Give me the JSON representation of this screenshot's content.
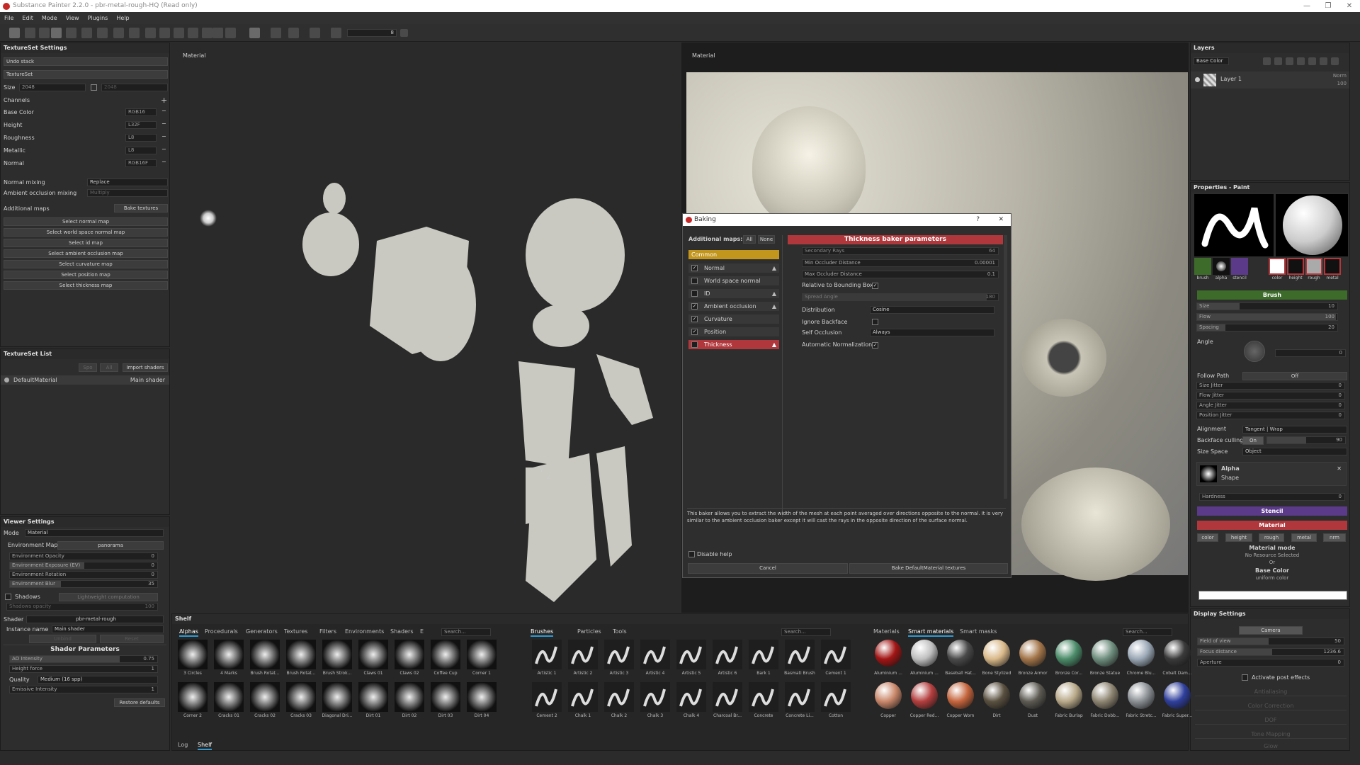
{
  "title": "Substance Painter 2.2.0 - pbr-metal-rough-HQ (Read only)",
  "menu": [
    "File",
    "Edit",
    "Mode",
    "View",
    "Plugins",
    "Help"
  ],
  "toolbar": {
    "brush_size": "8"
  },
  "textureset_settings": {
    "title": "TextureSet Settings",
    "undo": "Undo stack",
    "textureset": "TextureSet",
    "size_label": "Size",
    "size_value": "2048",
    "size_value2": "2048",
    "channels_label": "Channels",
    "channels": [
      {
        "name": "Base Color",
        "format": "RGB16"
      },
      {
        "name": "Height",
        "format": "L32F"
      },
      {
        "name": "Roughness",
        "format": "L8"
      },
      {
        "name": "Metallic",
        "format": "L8"
      },
      {
        "name": "Normal",
        "format": "RGB16F"
      }
    ],
    "normal_mixing_label": "Normal mixing",
    "normal_mixing": "Replace",
    "ao_mixing_label": "Ambient occlusion mixing",
    "ao_mixing": "Multiply",
    "additional_maps_label": "Additional maps",
    "bake_button": "Bake textures",
    "select_buttons": [
      "Select normal map",
      "Select world space normal map",
      "Select id map",
      "Select ambient occlusion map",
      "Select curvature map",
      "Select position map",
      "Select thickness map"
    ]
  },
  "textureset_list": {
    "title": "TextureSet List",
    "btn_a": "Spo",
    "btn_b": "All",
    "import_shaders": "Import shaders",
    "item": "DefaultMaterial",
    "shader": "Main shader"
  },
  "viewer_settings": {
    "title": "Viewer Settings",
    "mode_label": "Mode",
    "mode": "Material",
    "env_map_label": "Environment Map",
    "env_map": "panorama",
    "sliders": [
      {
        "label": "Environment Opacity",
        "value": "0"
      },
      {
        "label": "Environment Exposure (EV)",
        "value": "0"
      },
      {
        "label": "Environment Rotation",
        "value": "0"
      },
      {
        "label": "Environment Blur",
        "value": "35"
      }
    ],
    "shadows_label": "Shadows",
    "shadows_btn": "Lightweight computation",
    "shadows_opacity_label": "Shadows opacity",
    "shadows_opacity": "100",
    "shader_label": "Shader",
    "shader": "pbr-metal-rough",
    "instance_label": "Instance name",
    "instance": "Main shader",
    "btn_a": "Unbind",
    "btn_b": "Reset",
    "shader_params": "Shader Parameters",
    "params": [
      {
        "label": "AO Intensity",
        "value": "0.75"
      },
      {
        "label": "Height force",
        "value": "1"
      }
    ],
    "quality_label": "Quality",
    "quality": "Medium (16 spp)",
    "emissive_label": "Emissive Intensity",
    "emissive": "1",
    "restore": "Restore defaults"
  },
  "viewport_left": {
    "label": "Material"
  },
  "viewport_right": {
    "label": "Material"
  },
  "baking": {
    "title": "Baking",
    "help": "?",
    "close": "✕",
    "additional_maps": "Additional maps:",
    "all": "All",
    "none": "None",
    "common": "Common",
    "maps": [
      {
        "name": "Normal",
        "checked": true,
        "warn": true
      },
      {
        "name": "World space normal",
        "checked": false,
        "warn": false
      },
      {
        "name": "ID",
        "checked": false,
        "warn": true
      },
      {
        "name": "Ambient occlusion",
        "checked": true,
        "warn": true
      },
      {
        "name": "Curvature",
        "checked": true,
        "warn": false
      },
      {
        "name": "Position",
        "checked": true,
        "warn": false
      },
      {
        "name": "Thickness",
        "checked": false,
        "warn": true
      }
    ],
    "params_title": "Thickness baker parameters",
    "params": [
      {
        "label": "Secondary Rays",
        "value": "64"
      },
      {
        "label": "Min Occluder Distance",
        "value": "0.00001"
      },
      {
        "label": "Max Occluder Distance",
        "value": "0.1"
      },
      {
        "label": "Relative to Bounding Box",
        "value": "✓"
      },
      {
        "label": "Spread Angle",
        "value": "180"
      },
      {
        "label": "Distribution",
        "value": "Cosine"
      },
      {
        "label": "Ignore Backface",
        "value": ""
      },
      {
        "label": "Self Occlusion",
        "value": "Always"
      },
      {
        "label": "Automatic Normalization",
        "value": "✓"
      }
    ],
    "description": "This baker allows you to extract the width of the mesh at each point averaged over directions opposite to the normal. It is very similar to the ambient occlusion baker except it will cast the rays in the opposite direction of the surface normal.",
    "disable_help": "Disable help",
    "cancel": "Cancel",
    "bake": "Bake DefaultMaterial textures"
  },
  "layers": {
    "title": "Layers",
    "channel": "Base Color",
    "layer": "Layer 1",
    "blend": "Norm",
    "opacity": "100"
  },
  "properties": {
    "title": "Properties - Paint",
    "icons": [
      "brush",
      "alpha",
      "stencil",
      "color",
      "height",
      "rough",
      "metal"
    ],
    "brush": "Brush",
    "brush_params": [
      {
        "label": "Size",
        "value": "10"
      },
      {
        "label": "Flow",
        "value": "100"
      },
      {
        "label": "Spacing",
        "value": "20"
      }
    ],
    "angle_label": "Angle",
    "angle": "0",
    "follow_path_label": "Follow Path",
    "follow_path": "Off",
    "jitters": [
      {
        "label": "Size Jitter",
        "value": "0"
      },
      {
        "label": "Flow Jitter",
        "value": "0"
      },
      {
        "label": "Angle Jitter",
        "value": "0"
      },
      {
        "label": "Position Jitter",
        "value": "0"
      }
    ],
    "alignment_label": "Alignment",
    "alignment": "Tangent | Wrap",
    "backface_label": "Backface culling",
    "backface_on": "On",
    "backface_val": "90",
    "sizespace_label": "Size Space",
    "sizespace": "Object",
    "alpha": "Alpha",
    "shape": "Shape",
    "hardness_label": "Hardness",
    "hardness": "0",
    "stencil": "Stencil",
    "material": "Material",
    "mat_chips": [
      "color",
      "height",
      "rough",
      "metal",
      "nrm"
    ],
    "material_mode": "Material mode",
    "no_resource": "No Resource Selected",
    "or": "Or",
    "base_color": "Base Color",
    "uniform": "uniform color"
  },
  "display_settings": {
    "title": "Display Settings",
    "camera": "Camera",
    "fov_label": "Field of view",
    "fov": "50",
    "focus_label": "Focus distance",
    "focus": "1236.6",
    "aperture_label": "Aperture",
    "aperture": "0",
    "post_effects": "Activate post effects",
    "sections": [
      "Antialiasing",
      "Color Correction",
      "DOF",
      "Tone Mapping",
      "Glow"
    ]
  },
  "shelf": {
    "title": "Shelf",
    "tabs1": [
      "Alphas",
      "Procedurals",
      "Generators",
      "Textures",
      "Filters",
      "Environments",
      "Shaders",
      "E"
    ],
    "search": "Search...",
    "alphas": [
      "3 Circles",
      "4 Marks",
      "Brush Rotat...",
      "Brush Rotat...",
      "Brush Strok...",
      "Claws 01",
      "Claws 02",
      "Coffee Cup",
      "Corner 1",
      "Corner 2",
      "Cracks 01",
      "Cracks 02",
      "Cracks 03",
      "Diagonal Dri...",
      "Dirt 01",
      "Dirt 02",
      "Dirt 03",
      "Dirt 04"
    ],
    "tabs2": [
      "Brushes",
      "Particles",
      "Tools"
    ],
    "brushes": [
      "Artistic 1",
      "Artistic 2",
      "Artistic 3",
      "Artistic 4",
      "Artistic 5",
      "Artistic 6",
      "Bark 1",
      "Basmati Brush",
      "Cement 1",
      "Cement 2",
      "Chalk 1",
      "Chalk 2",
      "Chalk 3",
      "Chalk 4",
      "Charcoal Br...",
      "Concrete",
      "Concrete Li...",
      "Cotton"
    ],
    "tabs3": [
      "Materials",
      "Smart materials",
      "Smart masks"
    ],
    "materials": [
      "Aluminium ...",
      "Aluminium ...",
      "Baseball Hat...",
      "Bone Stylized",
      "Bronze Armor",
      "Bronze Cor...",
      "Bronze Statue",
      "Chrome Blu...",
      "Cobalt Dam...",
      "Copper",
      "Copper Red...",
      "Copper Worn",
      "Dirt",
      "Dust",
      "Fabric Burlap",
      "Fabric Dobb...",
      "Fabric Stretc...",
      "Fabric Super..."
    ],
    "bottom_tabs": [
      "Log",
      "Shelf"
    ]
  },
  "colors": {
    "accent_red": "#b0383c",
    "accent_yellow": "#c2951c",
    "accent_purple": "#5b3a8a",
    "accent_green": "#3c6b2a"
  }
}
